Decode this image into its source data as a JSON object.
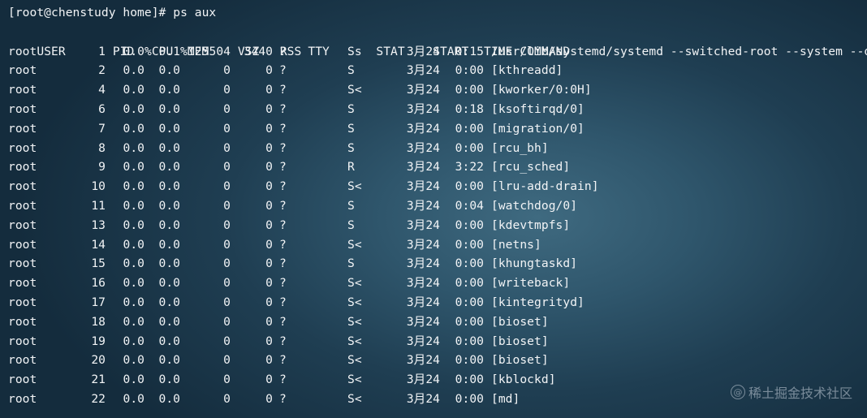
{
  "prompt": "[root@chenstudy home]# ps aux",
  "headers": {
    "user": "USER",
    "pid": "PID",
    "cpu": "%CPU",
    "mem": "%MEM",
    "vsz": "VSZ",
    "rss": "RSS",
    "tty": "TTY",
    "stat": "STAT",
    "start": "START",
    "time": "TIME",
    "command": "COMMAND"
  },
  "processes": [
    {
      "user": "root",
      "pid": "1",
      "cpu": "0.0",
      "mem": "0.1",
      "vsz": "125504",
      "rss": "3440",
      "tty": "?",
      "stat": "Ss",
      "start": "3月24",
      "time": "0:15",
      "command": "/usr/lib/systemd/systemd --switched-root --system --de"
    },
    {
      "user": "root",
      "pid": "2",
      "cpu": "0.0",
      "mem": "0.0",
      "vsz": "0",
      "rss": "0",
      "tty": "?",
      "stat": "S",
      "start": "3月24",
      "time": "0:00",
      "command": "[kthreadd]"
    },
    {
      "user": "root",
      "pid": "4",
      "cpu": "0.0",
      "mem": "0.0",
      "vsz": "0",
      "rss": "0",
      "tty": "?",
      "stat": "S<",
      "start": "3月24",
      "time": "0:00",
      "command": "[kworker/0:0H]"
    },
    {
      "user": "root",
      "pid": "6",
      "cpu": "0.0",
      "mem": "0.0",
      "vsz": "0",
      "rss": "0",
      "tty": "?",
      "stat": "S",
      "start": "3月24",
      "time": "0:18",
      "command": "[ksoftirqd/0]"
    },
    {
      "user": "root",
      "pid": "7",
      "cpu": "0.0",
      "mem": "0.0",
      "vsz": "0",
      "rss": "0",
      "tty": "?",
      "stat": "S",
      "start": "3月24",
      "time": "0:00",
      "command": "[migration/0]"
    },
    {
      "user": "root",
      "pid": "8",
      "cpu": "0.0",
      "mem": "0.0",
      "vsz": "0",
      "rss": "0",
      "tty": "?",
      "stat": "S",
      "start": "3月24",
      "time": "0:00",
      "command": "[rcu_bh]"
    },
    {
      "user": "root",
      "pid": "9",
      "cpu": "0.0",
      "mem": "0.0",
      "vsz": "0",
      "rss": "0",
      "tty": "?",
      "stat": "R",
      "start": "3月24",
      "time": "3:22",
      "command": "[rcu_sched]"
    },
    {
      "user": "root",
      "pid": "10",
      "cpu": "0.0",
      "mem": "0.0",
      "vsz": "0",
      "rss": "0",
      "tty": "?",
      "stat": "S<",
      "start": "3月24",
      "time": "0:00",
      "command": "[lru-add-drain]"
    },
    {
      "user": "root",
      "pid": "11",
      "cpu": "0.0",
      "mem": "0.0",
      "vsz": "0",
      "rss": "0",
      "tty": "?",
      "stat": "S",
      "start": "3月24",
      "time": "0:04",
      "command": "[watchdog/0]"
    },
    {
      "user": "root",
      "pid": "13",
      "cpu": "0.0",
      "mem": "0.0",
      "vsz": "0",
      "rss": "0",
      "tty": "?",
      "stat": "S",
      "start": "3月24",
      "time": "0:00",
      "command": "[kdevtmpfs]"
    },
    {
      "user": "root",
      "pid": "14",
      "cpu": "0.0",
      "mem": "0.0",
      "vsz": "0",
      "rss": "0",
      "tty": "?",
      "stat": "S<",
      "start": "3月24",
      "time": "0:00",
      "command": "[netns]"
    },
    {
      "user": "root",
      "pid": "15",
      "cpu": "0.0",
      "mem": "0.0",
      "vsz": "0",
      "rss": "0",
      "tty": "?",
      "stat": "S",
      "start": "3月24",
      "time": "0:00",
      "command": "[khungtaskd]"
    },
    {
      "user": "root",
      "pid": "16",
      "cpu": "0.0",
      "mem": "0.0",
      "vsz": "0",
      "rss": "0",
      "tty": "?",
      "stat": "S<",
      "start": "3月24",
      "time": "0:00",
      "command": "[writeback]"
    },
    {
      "user": "root",
      "pid": "17",
      "cpu": "0.0",
      "mem": "0.0",
      "vsz": "0",
      "rss": "0",
      "tty": "?",
      "stat": "S<",
      "start": "3月24",
      "time": "0:00",
      "command": "[kintegrityd]"
    },
    {
      "user": "root",
      "pid": "18",
      "cpu": "0.0",
      "mem": "0.0",
      "vsz": "0",
      "rss": "0",
      "tty": "?",
      "stat": "S<",
      "start": "3月24",
      "time": "0:00",
      "command": "[bioset]"
    },
    {
      "user": "root",
      "pid": "19",
      "cpu": "0.0",
      "mem": "0.0",
      "vsz": "0",
      "rss": "0",
      "tty": "?",
      "stat": "S<",
      "start": "3月24",
      "time": "0:00",
      "command": "[bioset]"
    },
    {
      "user": "root",
      "pid": "20",
      "cpu": "0.0",
      "mem": "0.0",
      "vsz": "0",
      "rss": "0",
      "tty": "?",
      "stat": "S<",
      "start": "3月24",
      "time": "0:00",
      "command": "[bioset]"
    },
    {
      "user": "root",
      "pid": "21",
      "cpu": "0.0",
      "mem": "0.0",
      "vsz": "0",
      "rss": "0",
      "tty": "?",
      "stat": "S<",
      "start": "3月24",
      "time": "0:00",
      "command": "[kblockd]"
    },
    {
      "user": "root",
      "pid": "22",
      "cpu": "0.0",
      "mem": "0.0",
      "vsz": "0",
      "rss": "0",
      "tty": "?",
      "stat": "S<",
      "start": "3月24",
      "time": "0:00",
      "command": "[md]"
    }
  ],
  "watermark": {
    "icon": "at-sign-icon",
    "symbol": "@",
    "text": "稀土掘金技术社区"
  },
  "colors": {
    "text": "#f2f4f6",
    "background_center": "#3f6a80",
    "background_edge": "#142c3d"
  }
}
